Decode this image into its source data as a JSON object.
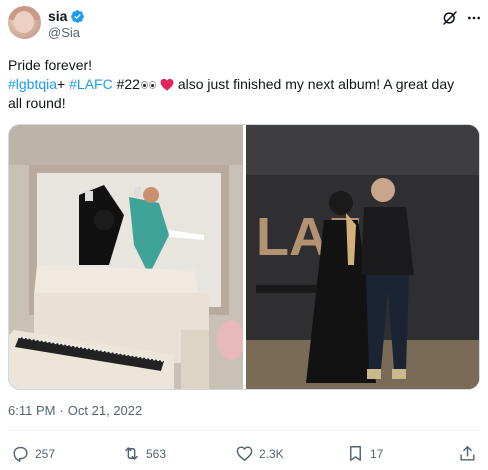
{
  "author": {
    "display_name": "sia",
    "handle": "@Sia",
    "verified": true,
    "avatar_icon": "profile-photo"
  },
  "header_icons": [
    "grok-icon",
    "more-icon"
  ],
  "tweet": {
    "line1": "Pride forever!",
    "hashtag1": "#lgbtqia",
    "plus": "+",
    "hashtag2": "#LAFC",
    "hashtag3": "#22",
    "line2_rest": " also just finished my next album! A great day",
    "line3": "all round!",
    "emojis": [
      "eyes-emoji",
      "red-heart-emoji"
    ]
  },
  "media": {
    "count": 2,
    "right_photo_sign": "LAFC"
  },
  "meta": {
    "time": "6:11 PM",
    "separator": "·",
    "date": "Oct 21, 2022"
  },
  "actions": {
    "replies": "257",
    "reposts": "563",
    "likes": "2.3K",
    "bookmarks": "17"
  },
  "colors": {
    "link": "#1d9bf0",
    "verified": "#1d9bf0",
    "secondary_text": "#536471",
    "heart": "#e0245e"
  }
}
